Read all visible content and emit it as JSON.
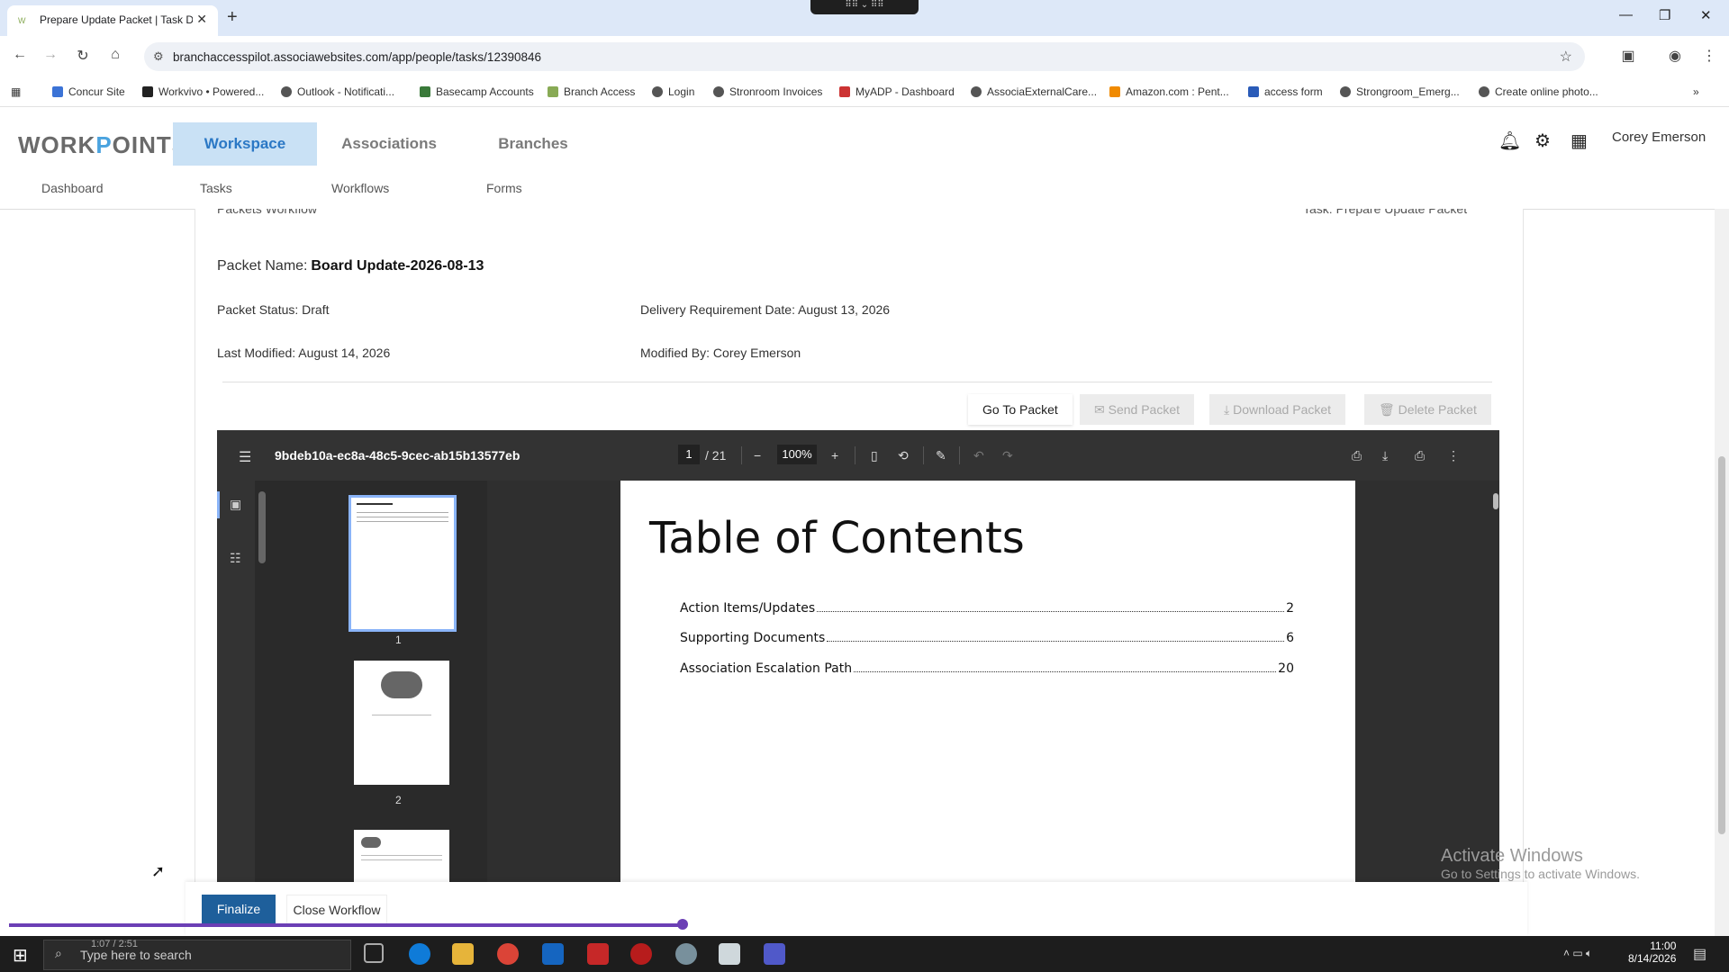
{
  "browser": {
    "tab_title": "Prepare Update Packet | Task D",
    "url": "branchaccesspilot.associawebsites.com/app/people/tasks/12390846",
    "bookmarks": [
      "Concur Site",
      "Workvivo • Powered...",
      "Outlook - Notificati...",
      "Basecamp Accounts",
      "Branch Access",
      "Login",
      "Stronroom Invoices",
      "MyADP - Dashboard",
      "AssociaExternalCare...",
      "Amazon.com : Pent...",
      "access form",
      "Strongroom_Emerg...",
      "Create online photo..."
    ]
  },
  "app": {
    "logo": {
      "part1": "WORK",
      "part2": "P",
      "part3": "OINTS",
      "plus": "+"
    },
    "nav": [
      "Workspace",
      "Associations",
      "Branches"
    ],
    "subnav": [
      "Dashboard",
      "Tasks",
      "Workflows",
      "Forms"
    ],
    "user": "Corey Emerson"
  },
  "packet": {
    "workflow_label": "Packets Workflow",
    "task_label": "Task: Prepare Update Packet",
    "name_label": "Packet Name:",
    "name_value": "Board Update-2026-08-13",
    "status": "Packet Status: Draft",
    "delivery": "Delivery Requirement Date: August 13, 2026",
    "last_modified": "Last Modified: August 14, 2026",
    "modified_by": "Modified By: Corey Emerson",
    "buttons": {
      "go": "Go To Packet",
      "send": "Send Packet",
      "download": "Download Packet",
      "delete": "Delete Packet"
    }
  },
  "pdf": {
    "filename": "9bdeb10a-ec8a-48c5-9cec-ab15b13577eb",
    "page": "1",
    "total": "/ 21",
    "zoom": "100%",
    "thumb_nums": [
      "1",
      "2"
    ],
    "toc_title": "Table of Contents",
    "toc": [
      {
        "label": "Action Items/Updates",
        "page": "2"
      },
      {
        "label": "Supporting Documents",
        "page": "6"
      },
      {
        "label": "Association Escalation Path",
        "page": "20"
      }
    ]
  },
  "overlay": {
    "line1": "Activate Windows",
    "line2": "Go to Settings to activate Windows."
  },
  "footer": {
    "finalize": "Finalize",
    "close": "Close Workflow"
  },
  "taskbar": {
    "search_placeholder": "Type here to search",
    "media_time": "1:07 / 2:51",
    "time": "11:00",
    "date": "8/14/2026"
  },
  "colors": {
    "accent": "#2b78c5",
    "primary_button": "#1e5f9b",
    "progress": "#6b3fb5"
  }
}
